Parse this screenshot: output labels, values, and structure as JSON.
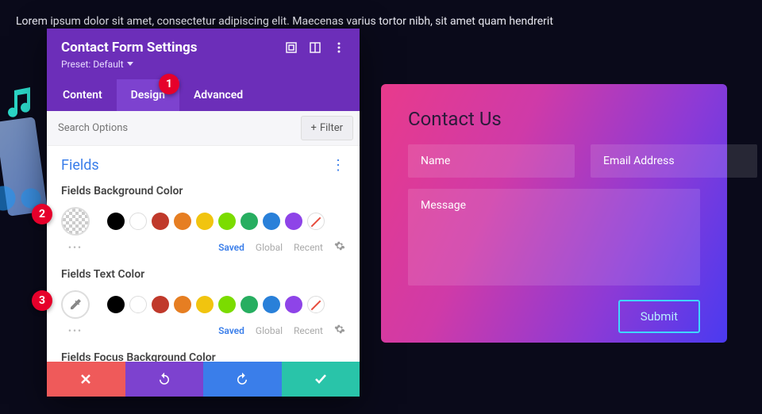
{
  "bg_text": "Lorem ipsum dolor sit amet, consectetur adipiscing elit. Maecenas varius tortor nibh, sit amet quam hendrerit",
  "annotations": {
    "a1": "1",
    "a2": "2",
    "a3": "3"
  },
  "panel": {
    "title": "Contact Form Settings",
    "preset_label": "Preset: Default",
    "tabs": {
      "content": "Content",
      "design": "Design",
      "advanced": "Advanced"
    },
    "search_placeholder": "Search Options",
    "filter_label": "Filter",
    "section_title": "Fields",
    "field1_label": "Fields Background Color",
    "field2_label": "Fields Text Color",
    "field3_label": "Fields Focus Background Color",
    "sub": {
      "saved": "Saved",
      "global": "Global",
      "recent": "Recent"
    }
  },
  "swatches": [
    "black",
    "white",
    "red",
    "orange",
    "yellow",
    "lime",
    "green",
    "blue",
    "purple",
    "none"
  ],
  "preview": {
    "title": "Contact Us",
    "name_placeholder": "Name",
    "email_placeholder": "Email Address",
    "message_placeholder": "Message",
    "submit_label": "Submit"
  }
}
